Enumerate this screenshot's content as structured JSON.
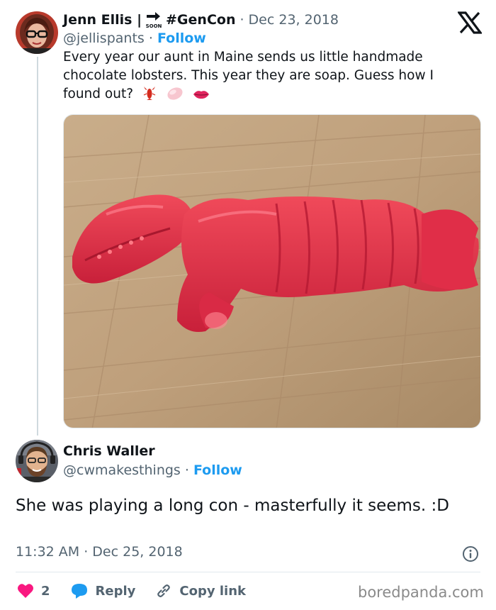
{
  "tweet1": {
    "author_name": "Jenn Ellis |",
    "hashtag": "#GenCon",
    "soon_label": "SOON",
    "date": "· Dec 23, 2018",
    "handle": "@jellispants",
    "separator": "·",
    "follow_label": "Follow",
    "text": "Every year our aunt in Maine sends us little handmade chocolate lobsters. This year they are soap. Guess how I found out?",
    "emojis": [
      "lobster-emoji",
      "soap-emoji",
      "lips-emoji"
    ]
  },
  "tweet2": {
    "author_name": "Chris Waller",
    "handle": "@cwmakesthings",
    "separator": "·",
    "follow_label": "Follow",
    "text": "She was playing a long con - masterfully it seems. :D",
    "time": "11:32 AM · Dec 25, 2018"
  },
  "actions": {
    "like_count": "2",
    "reply_label": "Reply",
    "copy_link_label": "Copy link"
  },
  "credit": "boredpanda.com",
  "colors": {
    "accent": "#1d9bf0",
    "like": "#f91880",
    "muted": "#536471"
  }
}
